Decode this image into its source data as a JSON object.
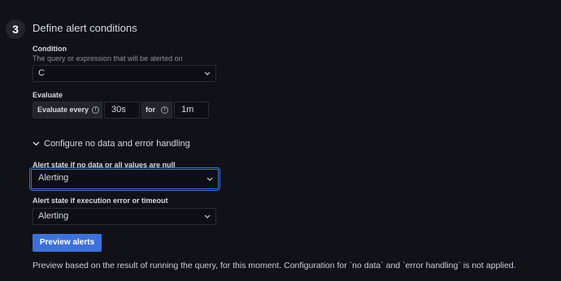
{
  "step": {
    "number": "3",
    "title": "Define alert conditions"
  },
  "condition": {
    "label": "Condition",
    "description": "The query or expression that will be alerted on",
    "value": "C"
  },
  "evaluate": {
    "label": "Evaluate",
    "every_label": "Evaluate every",
    "every_value": "30s",
    "for_label": "for",
    "for_value": "1m"
  },
  "no_data_section": {
    "toggle_label": "Configure no data and error handling",
    "no_data_label": "Alert state if no data or all values are null",
    "no_data_value": "Alerting",
    "error_label": "Alert state if execution error or timeout",
    "error_value": "Alerting"
  },
  "preview": {
    "button_label": "Preview alerts",
    "note": "Preview based on the result of running the query, for this moment. Configuration for `no data` and `error handling` is not applied."
  },
  "colors": {
    "background": "#111217",
    "accent": "#3d71d9",
    "input_bg": "#0e0f14",
    "border": "#2a2d35"
  }
}
